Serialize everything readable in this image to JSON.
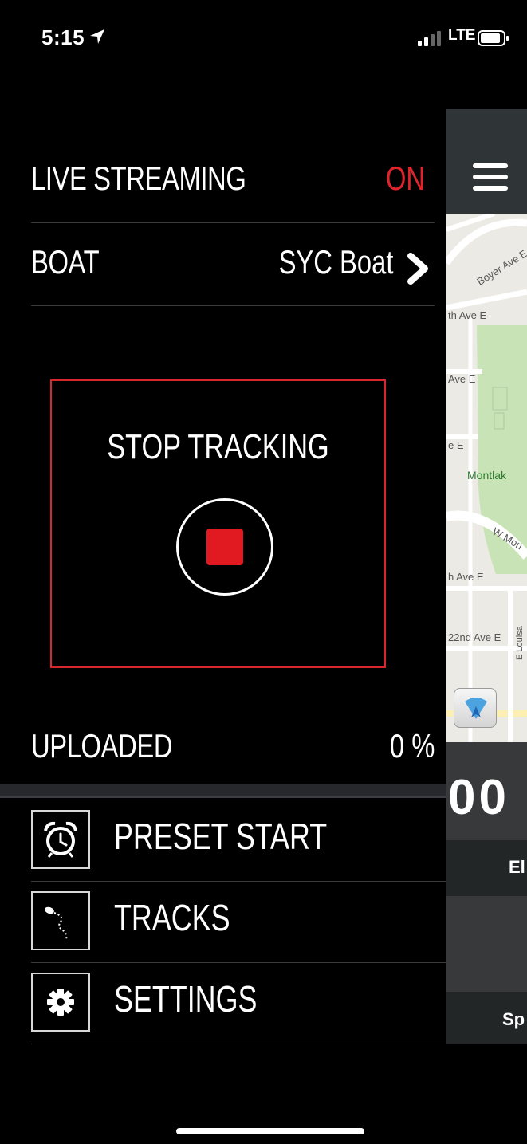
{
  "status_bar": {
    "time": "5:15",
    "network": "LTE",
    "location_icon": "location-arrow-icon",
    "signal_icon": "cellular-signal-icon",
    "battery_icon": "battery-icon"
  },
  "live_streaming": {
    "label": "LIVE STREAMING",
    "value": "ON",
    "value_color": "#e1242b"
  },
  "boat": {
    "label": "BOAT",
    "value": "SYC Boat",
    "chevron_icon": "chevron-right-icon"
  },
  "tracking": {
    "label": "STOP TRACKING",
    "button_icon": "stop-icon",
    "accent_color": "#d7262c"
  },
  "uploaded": {
    "label": "UPLOADED",
    "value": "0 %",
    "progress": 0
  },
  "menu": {
    "items": [
      {
        "label": "PRESET START",
        "icon": "alarm-clock-icon"
      },
      {
        "label": "TRACKS",
        "icon": "track-path-icon"
      },
      {
        "label": "SETTINGS",
        "icon": "gear-icon"
      }
    ]
  },
  "peek_panel": {
    "menu_icon": "hamburger-menu-icon",
    "map_labels": [
      "Boyer Ave E",
      "th Ave E",
      "Ave E",
      "e E",
      "Montlak",
      "W Mon",
      "h Ave E",
      "22nd Ave E",
      "E Louisa"
    ],
    "locate_icon": "locate-arrow-icon",
    "value": "00",
    "band_labels": [
      "El",
      "Sp"
    ]
  }
}
